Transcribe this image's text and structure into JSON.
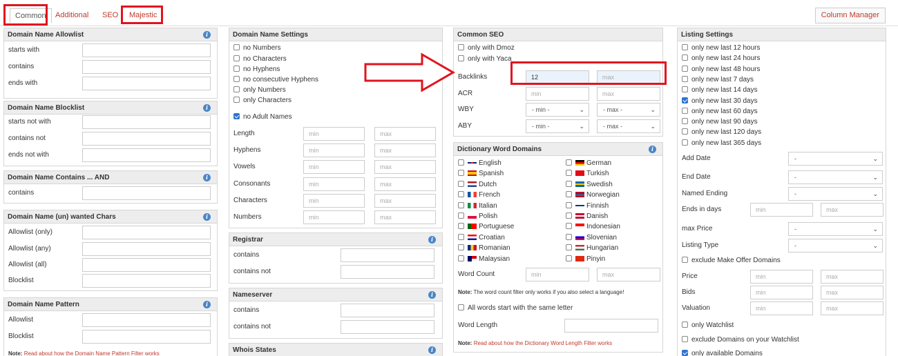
{
  "tabs": [
    {
      "label": "Common"
    },
    {
      "label": "Additional"
    },
    {
      "label": "SEO"
    },
    {
      "label": "Majestic"
    }
  ],
  "column_manager": "Column Manager",
  "col1": {
    "allowlist": {
      "title": "Domain Name Allowlist",
      "rows": [
        "starts with",
        "contains",
        "ends with"
      ]
    },
    "blocklist": {
      "title": "Domain Name Blocklist",
      "rows": [
        "starts not with",
        "contains not",
        "ends not with"
      ]
    },
    "contains_and": {
      "title": "Domain Name Contains ... AND",
      "rows": [
        "contains"
      ]
    },
    "unwanted": {
      "title": "Domain Name (un) wanted Chars",
      "rows": [
        "Allowlist (only)",
        "Allowlist (any)",
        "Allowlist (all)",
        "Blocklist"
      ]
    },
    "pattern": {
      "title": "Domain Name Pattern",
      "rows": [
        "Allowlist",
        "Blocklist"
      ],
      "note_bold": "Note:",
      "note_link": "Read about how the Domain Name Pattern Filter works"
    }
  },
  "col2": {
    "settings": {
      "title": "Domain Name Settings",
      "checks": [
        {
          "label": "no Numbers",
          "checked": false
        },
        {
          "label": "no Characters",
          "checked": false
        },
        {
          "label": "no Hyphens",
          "checked": false
        },
        {
          "label": "no consecutive Hyphens",
          "checked": false
        },
        {
          "label": "only Numbers",
          "checked": false
        },
        {
          "label": "only Characters",
          "checked": false
        }
      ],
      "adult": {
        "label": "no Adult Names",
        "checked": true
      },
      "ranges": [
        "Length",
        "Hyphens",
        "Vowels",
        "Consonants",
        "Characters",
        "Numbers"
      ],
      "min": "min",
      "max": "max"
    },
    "registrar": {
      "title": "Registrar",
      "rows": [
        "contains",
        "contains not"
      ]
    },
    "nameserver": {
      "title": "Nameserver",
      "rows": [
        "contains",
        "contains not"
      ]
    },
    "whois": {
      "title": "Whois States"
    }
  },
  "col3": {
    "seo": {
      "title": "Common SEO",
      "checks": [
        "only with Dmoz",
        "only with Yaca"
      ],
      "backlinks": {
        "label": "Backlinks",
        "min_value": "12",
        "max": "max"
      },
      "acr": {
        "label": "ACR",
        "min": "min",
        "max": "max"
      },
      "wby": {
        "label": "WBY",
        "min": "- min -",
        "max": "- max -"
      },
      "aby": {
        "label": "ABY",
        "min": "- min -",
        "max": "- max -"
      }
    },
    "dict": {
      "title": "Dictionary Word Domains",
      "left": [
        "English",
        "Spanish",
        "Dutch",
        "French",
        "Italian",
        "Polish",
        "Portuguese",
        "Croatian",
        "Romanian",
        "Malaysian"
      ],
      "right": [
        "German",
        "Turkish",
        "Swedish",
        "Norwegian",
        "Finnish",
        "Danish",
        "Indonesian",
        "Slovenian",
        "Hungarian",
        "Pinyin"
      ],
      "word_count": "Word Count",
      "min": "min",
      "max": "max",
      "note_bold": "Note:",
      "note_text": "The word count filter only works if you also select a language!",
      "same_letter": "All words start with the same letter",
      "word_length": "Word Length",
      "note2_link": "Read about how the Dictionary Word Length Filter works"
    }
  },
  "col4": {
    "title": "Listing Settings",
    "checks": [
      {
        "label": "only new last 12 hours",
        "checked": false
      },
      {
        "label": "only new last 24 hours",
        "checked": false
      },
      {
        "label": "only new last 48 hours",
        "checked": false
      },
      {
        "label": "only new last 7 days",
        "checked": false
      },
      {
        "label": "only new last 14 days",
        "checked": false
      },
      {
        "label": "only new last 30 days",
        "checked": true
      },
      {
        "label": "only new last 60 days",
        "checked": false
      },
      {
        "label": "only new last 90 days",
        "checked": false
      },
      {
        "label": "only new last 120 days",
        "checked": false
      },
      {
        "label": "only new last 365 days",
        "checked": false
      }
    ],
    "add_date": "Add Date",
    "end_date": "End Date",
    "named_ending": "Named Ending",
    "ends_in_days": "Ends in days",
    "max_price": "max Price",
    "listing_type": "Listing Type",
    "dash": "-",
    "exclude_make_offer": "exclude Make Offer Domains",
    "price": "Price",
    "bids": "Bids",
    "valuation": "Valuation",
    "only_watchlist": "only Watchlist",
    "exclude_watchlist": "exclude Domains on your Watchlist",
    "only_available": "only available Domains",
    "min": "min",
    "max": "max"
  },
  "colors": {
    "accent": "#c0392b",
    "highlight": "#e0141e",
    "checkbox": "#2f74d0"
  }
}
